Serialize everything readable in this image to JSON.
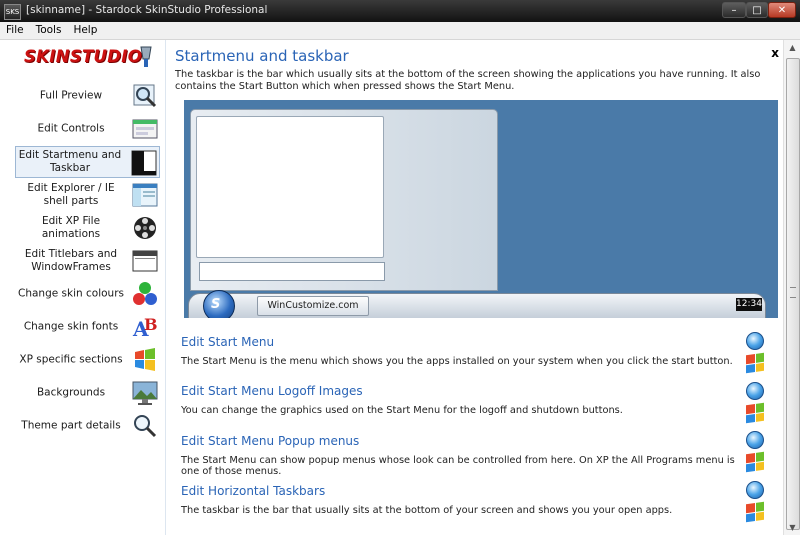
{
  "window": {
    "title": "[skinname] - Stardock SkinStudio Professional",
    "app_icon_text": "SKS"
  },
  "menu": [
    "File",
    "Tools",
    "Help"
  ],
  "logo": {
    "text": "SKINSTUDIO"
  },
  "sidebar": {
    "items": [
      {
        "label": "Full Preview",
        "icon": "magnifier-icon"
      },
      {
        "label": "Edit Controls",
        "icon": "controls-icon"
      },
      {
        "label": "Edit Startmenu and Taskbar",
        "icon": "startmenu-icon",
        "active": true
      },
      {
        "label": "Edit Explorer / IE shell parts",
        "icon": "explorer-icon"
      },
      {
        "label": "Edit XP File animations",
        "icon": "film-reel-icon"
      },
      {
        "label": "Edit Titlebars and WindowFrames",
        "icon": "window-frame-icon"
      },
      {
        "label": "Change skin colours",
        "icon": "color-balls-icon"
      },
      {
        "label": "Change skin fonts",
        "icon": "font-ab-icon"
      },
      {
        "label": "XP specific sections",
        "icon": "windows-flag-icon"
      },
      {
        "label": "Backgrounds",
        "icon": "background-icon"
      },
      {
        "label": "Theme part details",
        "icon": "magnifier-small-icon"
      }
    ]
  },
  "main": {
    "title": "Startmenu and taskbar",
    "close_label": "x",
    "description": "The taskbar is the bar which usually sits at the bottom of the screen showing the applications you have running.  It also contains the Start Button which when pressed shows the Start Menu.",
    "preview": {
      "taskbar_button_label": "WinCustomize.com",
      "clock": "12:34"
    },
    "sections": [
      {
        "title": "Edit Start Menu",
        "description": "The Start Menu is the menu which shows you the apps installed on your system when you click the start button."
      },
      {
        "title": "Edit Start Menu Logoff Images",
        "description": "You can change the graphics used on the Start Menu for the logoff and shutdown buttons."
      },
      {
        "title": "Edit Start Menu Popup menus",
        "description": "The Start Menu can show popup menus whose look can be controlled from here.  On XP the All Programs menu is one of those menus."
      },
      {
        "title": "Edit Horizontal Taskbars",
        "description": "The taskbar is the bar that usually sits at the bottom of your screen and shows you your open apps."
      }
    ]
  },
  "colors": {
    "heading_blue": "#2a64b6",
    "preview_desktop": "#4a7aa8",
    "logo_red": "#cc1111"
  }
}
